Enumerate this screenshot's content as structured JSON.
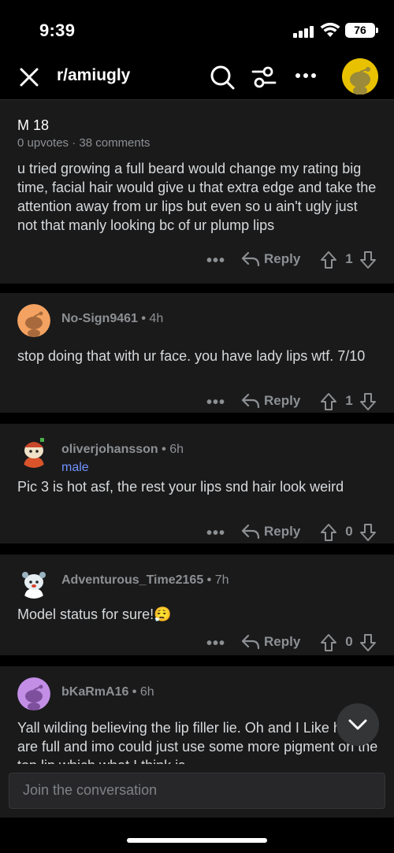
{
  "status": {
    "time": "9:39",
    "battery": "76"
  },
  "nav": {
    "subreddit": "r/amiugly"
  },
  "post": {
    "title": "M 18",
    "meta": "0 upvotes · 38 comments"
  },
  "comments": [
    {
      "body": "u tried growing a full beard would change my rating big time, facial hair would give u that extra edge and take the attention away from ur lips but even so u ain't ugly just not that manly looking bc of ur plump lips",
      "reply_label": "Reply",
      "votes": "1"
    },
    {
      "author": "No-Sign9461",
      "age": "4h",
      "body": "stop doing that with ur face. you have lady lips wtf. 7/10",
      "reply_label": "Reply",
      "votes": "1",
      "avatar_color": "#f4a261"
    },
    {
      "author": "oliverjohansson",
      "age": "6h",
      "flair": "male",
      "body": "Pic 3 is hot asf, the rest your lips snd hair look weird",
      "reply_label": "Reply",
      "votes": "0"
    },
    {
      "author": "Adventurous_Time2165",
      "age": "7h",
      "body": "Model status for sure!😮‍💨",
      "reply_label": "Reply",
      "votes": "0"
    },
    {
      "author": "bKaRmA16",
      "age": "6h",
      "body": "Yall wilding believing the lip filler lie. Oh and I Like his lips are full and imo could just use some more pigment on the top lip which what I think is",
      "avatar_color": "#c28ee6"
    }
  ],
  "composer": {
    "placeholder": "Join the conversation"
  },
  "colors": {
    "background": "#000000",
    "card": "#1a1a1b",
    "meta_text": "#8d9093",
    "flair": "#7193ff",
    "snoo_yellow": "#e8c100"
  }
}
